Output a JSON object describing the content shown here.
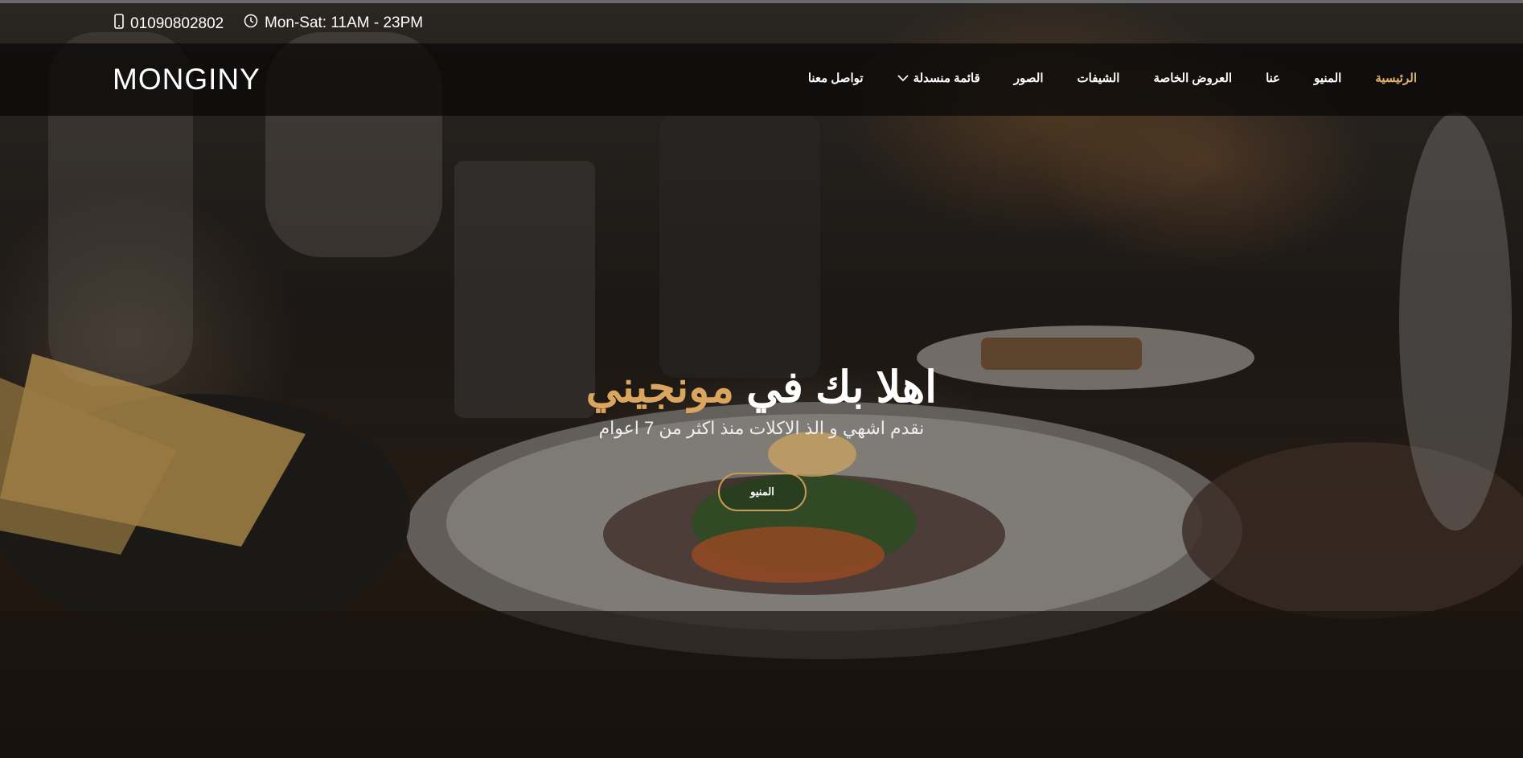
{
  "topbar": {
    "phone": "01090802802",
    "hours": "Mon-Sat: 11AM - 23PM",
    "phone_icon": "mobile-phone-icon",
    "clock_icon": "clock-icon"
  },
  "navbar": {
    "brand": "MONGINY",
    "items": [
      {
        "label": "الرئيسية",
        "active": true
      },
      {
        "label": "المنيو"
      },
      {
        "label": "عنا"
      },
      {
        "label": "العروض الخاصة"
      },
      {
        "label": "الشيفات"
      },
      {
        "label": "الصور"
      },
      {
        "label": "قائمة منسدلة",
        "icon": "chevron-down-icon"
      },
      {
        "label": "تواصل معنا"
      }
    ]
  },
  "hero": {
    "title_prefix": "اهلا بك في ",
    "title_accent": "مونجيني",
    "subtitle": "نقدم اشهي و الذ الاكلات منذ اكثر من 7 اعوام",
    "button_label": "المنيو"
  },
  "colors": {
    "accent": "#d9a55f",
    "nav_background": "#0a0908",
    "button_border": "#c79a52"
  }
}
